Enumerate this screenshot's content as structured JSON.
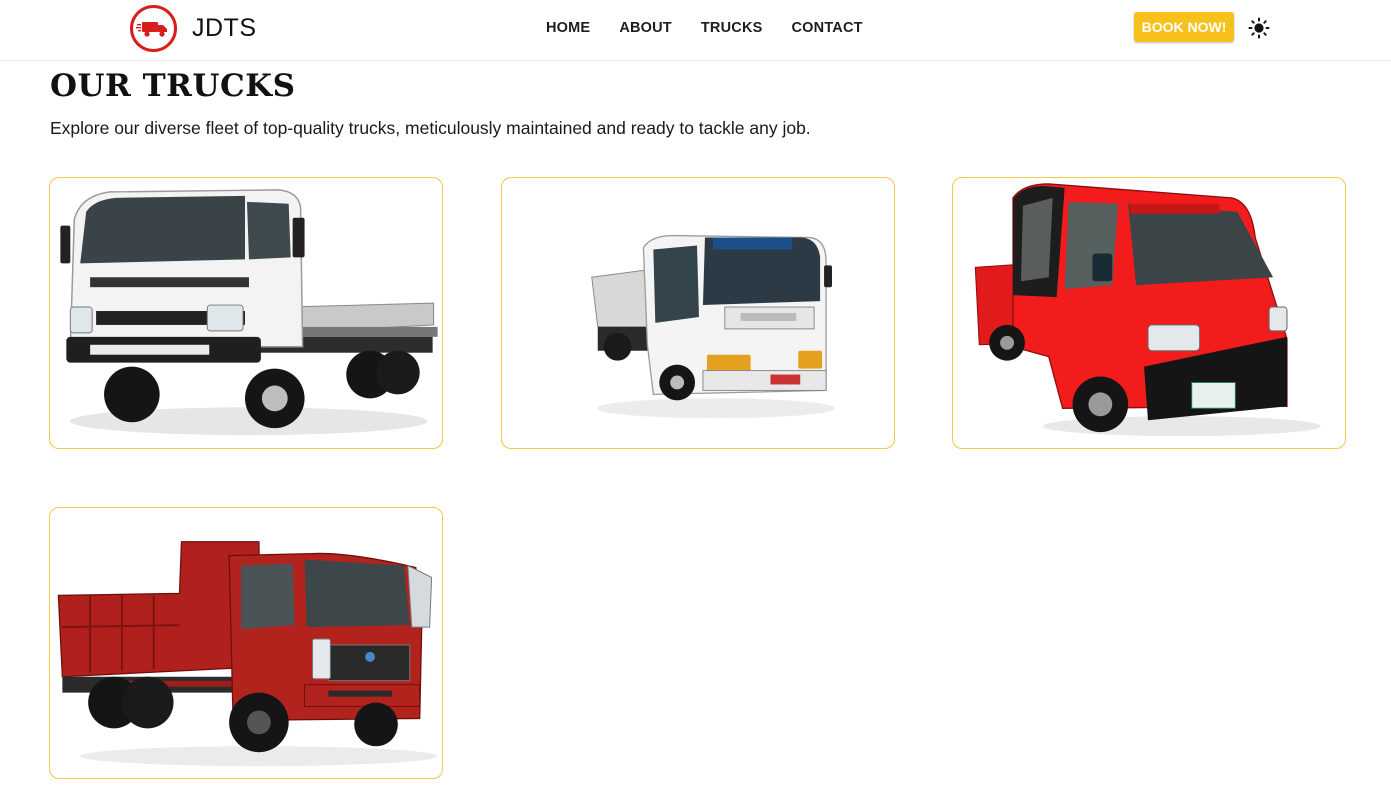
{
  "brand": {
    "name": "JDTS",
    "logo_icon": "truck-logo-icon"
  },
  "nav": {
    "links": [
      "HOME",
      "ABOUT",
      "TRUCKS",
      "CONTACT"
    ],
    "book_label": "BOOK NOW!",
    "theme_icon": "sun-icon"
  },
  "colors": {
    "accent": "#f7c11b",
    "logo_red": "#d91c1c",
    "card_border": "#f2c94c"
  },
  "main": {
    "title": "OUR TRUCKS",
    "subtitle": "Explore our diverse fleet of top-quality trucks, meticulously maintained and ready to tackle any job."
  },
  "trucks": [
    {
      "image": "white-flatbed-truck-image"
    },
    {
      "image": "white-dump-truck-image"
    },
    {
      "image": "red-mini-truck-image"
    },
    {
      "image": "red-dump-truck-image"
    }
  ]
}
